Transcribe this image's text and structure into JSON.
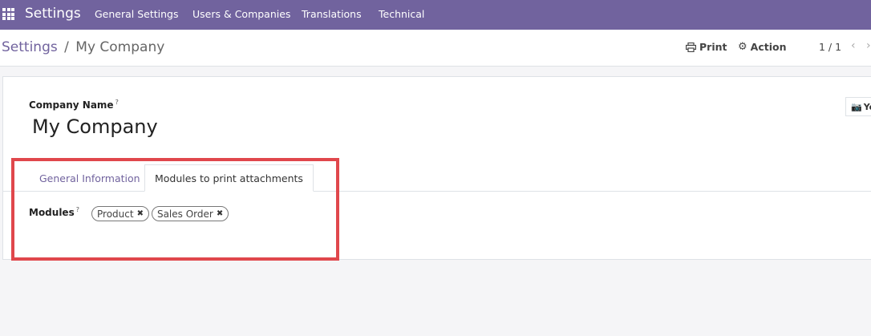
{
  "navbar": {
    "brand": "Settings",
    "menu": [
      "General Settings",
      "Users & Companies",
      "Translations",
      "Technical"
    ],
    "bg_color": "#71639e"
  },
  "control_panel": {
    "breadcrumb_parent": "Settings",
    "breadcrumb_separator": "/",
    "breadcrumb_current": "My Company",
    "print_label": "Print",
    "action_label": "Action",
    "pager": "1 / 1"
  },
  "form": {
    "company_name_label": "Company Name",
    "help_mark": "?",
    "company_name": "My Company",
    "avatar_button_label": "Yo",
    "tabs": [
      {
        "label": "General Information",
        "active": false
      },
      {
        "label": "Modules to print attachments",
        "active": true
      }
    ],
    "modules_label": "Modules",
    "modules": [
      "Product",
      "Sales Order"
    ]
  },
  "highlight_color": "#e0474c"
}
